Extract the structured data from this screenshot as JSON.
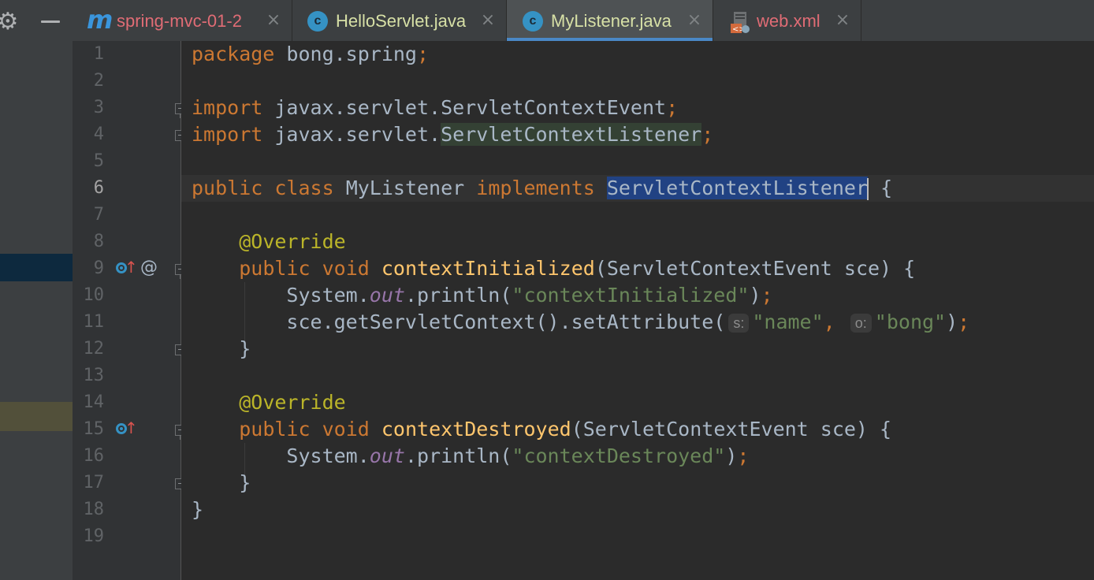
{
  "tabs": [
    {
      "label": "spring-mvc-01-2",
      "icon": "maven-module-icon",
      "color": "#e06c75",
      "active": false
    },
    {
      "label": "HelloServlet.java",
      "icon": "java-class-icon",
      "color": "#d7e0a6",
      "active": false
    },
    {
      "label": "MyListener.java",
      "icon": "java-class-icon",
      "color": "#d7e0a6",
      "active": true
    },
    {
      "label": "web.xml",
      "icon": "xml-file-icon",
      "color": "#e06c75",
      "active": false
    }
  ],
  "tab_close_glyph": "×",
  "toolbar": {
    "gear_icon": "gear-icon",
    "hide_icon": "minus-icon"
  },
  "code": {
    "line_numbers": [
      "1",
      "2",
      "3",
      "4",
      "5",
      "6",
      "7",
      "8",
      "9",
      "10",
      "11",
      "12",
      "13",
      "14",
      "15",
      "16",
      "17",
      "18",
      "19"
    ],
    "current_line": 6,
    "line1": {
      "kw": "package",
      "rest": " bong.spring",
      "semi": ";"
    },
    "line3": {
      "kw": "import",
      "rest": " javax.servlet.ServletContextEvent",
      "semi": ";"
    },
    "line4": {
      "kw": "import",
      "rest": " javax.servlet.",
      "unused": "ServletContextListener",
      "semi": ";"
    },
    "line6": {
      "kw1": "public",
      "kw2": "class",
      "name": "MyListener",
      "kw3": "implements",
      "selected": "ServletContextListener",
      "brace": "{"
    },
    "line8": {
      "annotation": "@Override"
    },
    "line9": {
      "kw1": "public",
      "kw2": "void",
      "method": "contextInitialized",
      "params": "(ServletContextEvent sce) {"
    },
    "line10": {
      "obj": "System.",
      "field": "out",
      "call": ".println(",
      "str": "\"contextInitialized\"",
      "end": ")",
      "semi": ";"
    },
    "line11": {
      "call": "sce.getServletContext().setAttribute(",
      "hint1": "s:",
      "str1": "\"name\"",
      "comma": ",",
      "hint2": "o:",
      "str2": "\"bong\"",
      "end": ")",
      "semi": ";"
    },
    "line12": {
      "brace": "}"
    },
    "line14": {
      "annotation": "@Override"
    },
    "line15": {
      "kw1": "public",
      "kw2": "void",
      "method": "contextDestroyed",
      "params": "(ServletContextEvent sce) {"
    },
    "line16": {
      "obj": "System.",
      "field": "out",
      "call": ".println(",
      "str": "\"contextDestroyed\"",
      "end": ")",
      "semi": ";"
    },
    "line17": {
      "brace": "}"
    },
    "line18": {
      "brace": "}"
    }
  },
  "gutter": {
    "line9_icons": [
      "implementing-method-icon",
      "up-arrow-icon",
      "at-annotation-icon"
    ],
    "line15_icons": [
      "implementing-method-icon",
      "up-arrow-icon"
    ],
    "at_glyph": "@",
    "arrow_glyph": "↑"
  },
  "colors": {
    "keyword": "#cc7832",
    "annotation": "#bbb529",
    "method": "#ffc66d",
    "string": "#6a8759",
    "static_field": "#9876aa",
    "text": "#a9b7c6",
    "selection": "#214283",
    "background": "#2b2b2b"
  }
}
